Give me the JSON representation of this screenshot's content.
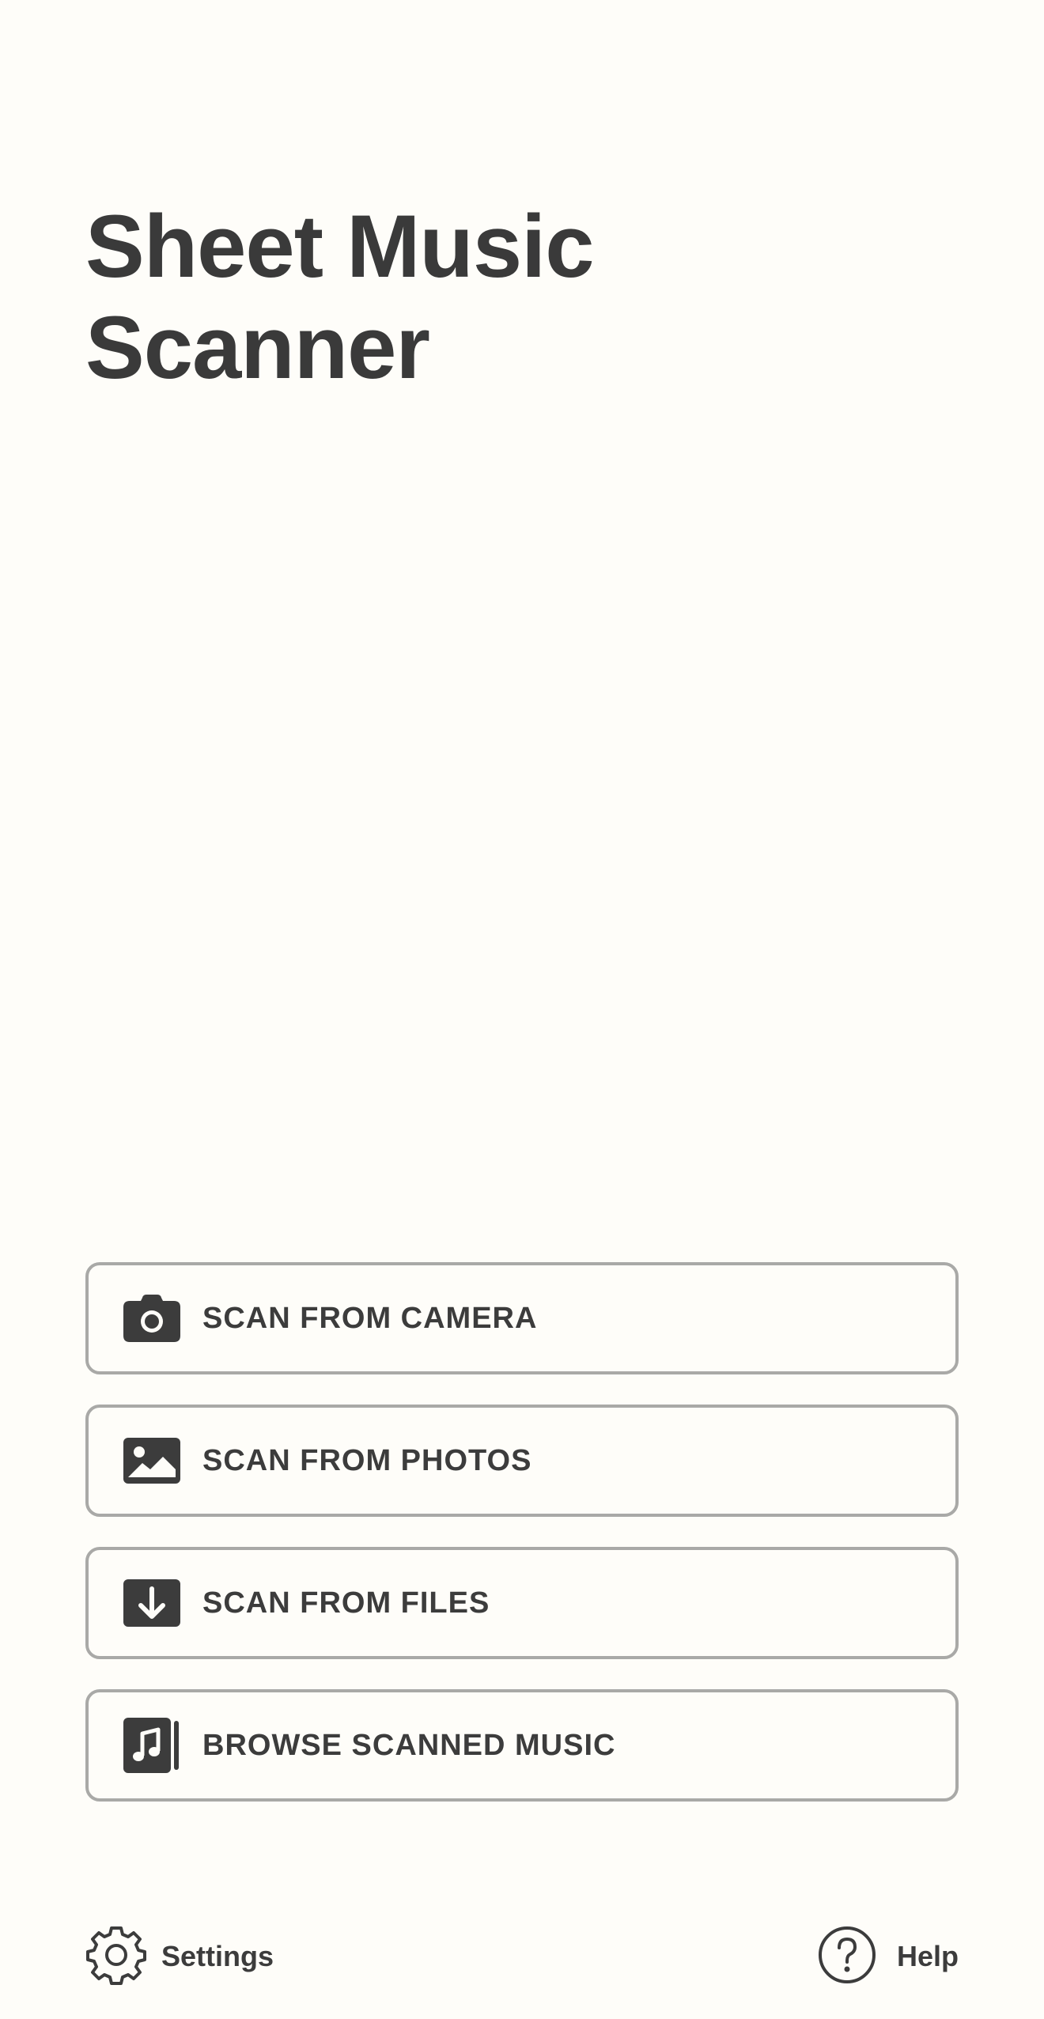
{
  "app": {
    "title_line1": "Sheet Music",
    "title_line2": "Scanner"
  },
  "actions": [
    {
      "label": "SCAN FROM CAMERA",
      "icon": "camera-icon"
    },
    {
      "label": "SCAN FROM PHOTOS",
      "icon": "photo-icon"
    },
    {
      "label": "SCAN FROM FILES",
      "icon": "download-file-icon"
    },
    {
      "label": "BROWSE SCANNED MUSIC",
      "icon": "music-library-icon"
    }
  ],
  "footer": {
    "settings_label": "Settings",
    "settings_icon": "gear-icon",
    "help_label": "Help",
    "help_icon": "question-circle-icon"
  },
  "colors": {
    "background": "#fefdf9",
    "text": "#3c3c3c",
    "button_border": "#a9a9a7"
  }
}
